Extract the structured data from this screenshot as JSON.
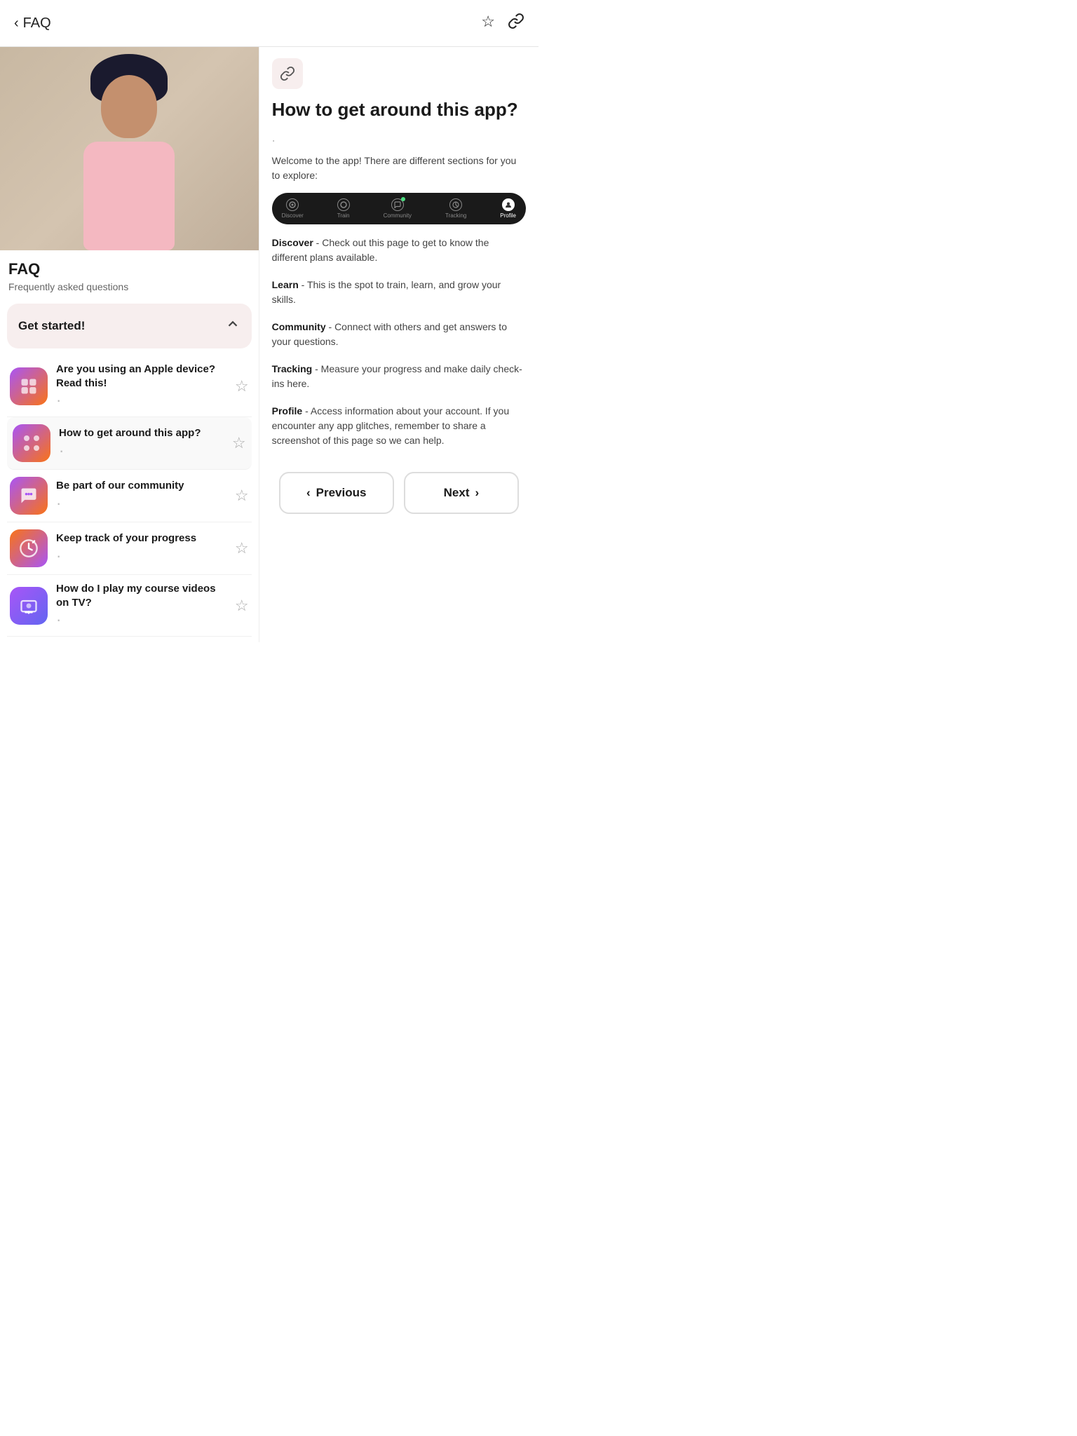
{
  "header": {
    "back_label": "< FAQ",
    "title": "FAQ",
    "bookmark_icon": "☆",
    "link_icon": "⚇"
  },
  "hero": {
    "alt": "Person with dark hair wearing pink top"
  },
  "page_meta": {
    "title": "FAQ",
    "subtitle": "Frequently asked questions"
  },
  "accordion": {
    "label": "Get started!",
    "open": true
  },
  "faq_items": [
    {
      "id": "apple",
      "title": "Are you using an Apple device? Read this!",
      "icon": "✋",
      "icon_class": "faq-icon-apple"
    },
    {
      "id": "navigate",
      "title": "How to get around this app?",
      "icon": "⊞",
      "icon_class": "faq-icon-nav"
    },
    {
      "id": "community",
      "title": "Be part of our community",
      "icon": "💬",
      "icon_class": "faq-icon-community"
    },
    {
      "id": "track",
      "title": "Keep track of your progress",
      "icon": "↻",
      "icon_class": "faq-icon-track"
    },
    {
      "id": "tv",
      "title": "How do I play my course videos on TV?",
      "icon": "⊡",
      "icon_class": "faq-icon-tv"
    }
  ],
  "article": {
    "link_icon": "⚇",
    "title": "How to get around this app?",
    "dot": ".",
    "intro": "Welcome to the app! There are different sections for you to explore:",
    "nav_items": [
      {
        "label": "Discover",
        "active": false,
        "icon": "◎"
      },
      {
        "label": "Train",
        "active": false,
        "icon": "◎"
      },
      {
        "label": "Community",
        "active": false,
        "icon": "◎",
        "dot": true
      },
      {
        "label": "Tracking",
        "active": false,
        "icon": "◎"
      },
      {
        "label": "Profile",
        "active": true,
        "icon": "◉"
      }
    ],
    "sections": [
      {
        "heading": "Discover",
        "text": " - Check out this page to get to know the different plans available."
      },
      {
        "heading": "Learn",
        "text": " - This is the spot to train, learn, and grow your skills."
      },
      {
        "heading": "Community",
        "text": " - Connect with others and get answers to your questions."
      },
      {
        "heading": "Tracking",
        "text": " - Measure your progress and make daily check-ins here."
      },
      {
        "heading": "Profile",
        "text": " - Access information about your account. If you encounter any app glitches, remember to share a screenshot of this page so we can help."
      }
    ]
  },
  "navigation": {
    "previous_label": "Previous",
    "next_label": "Next",
    "prev_icon": "‹",
    "next_icon": "›"
  }
}
